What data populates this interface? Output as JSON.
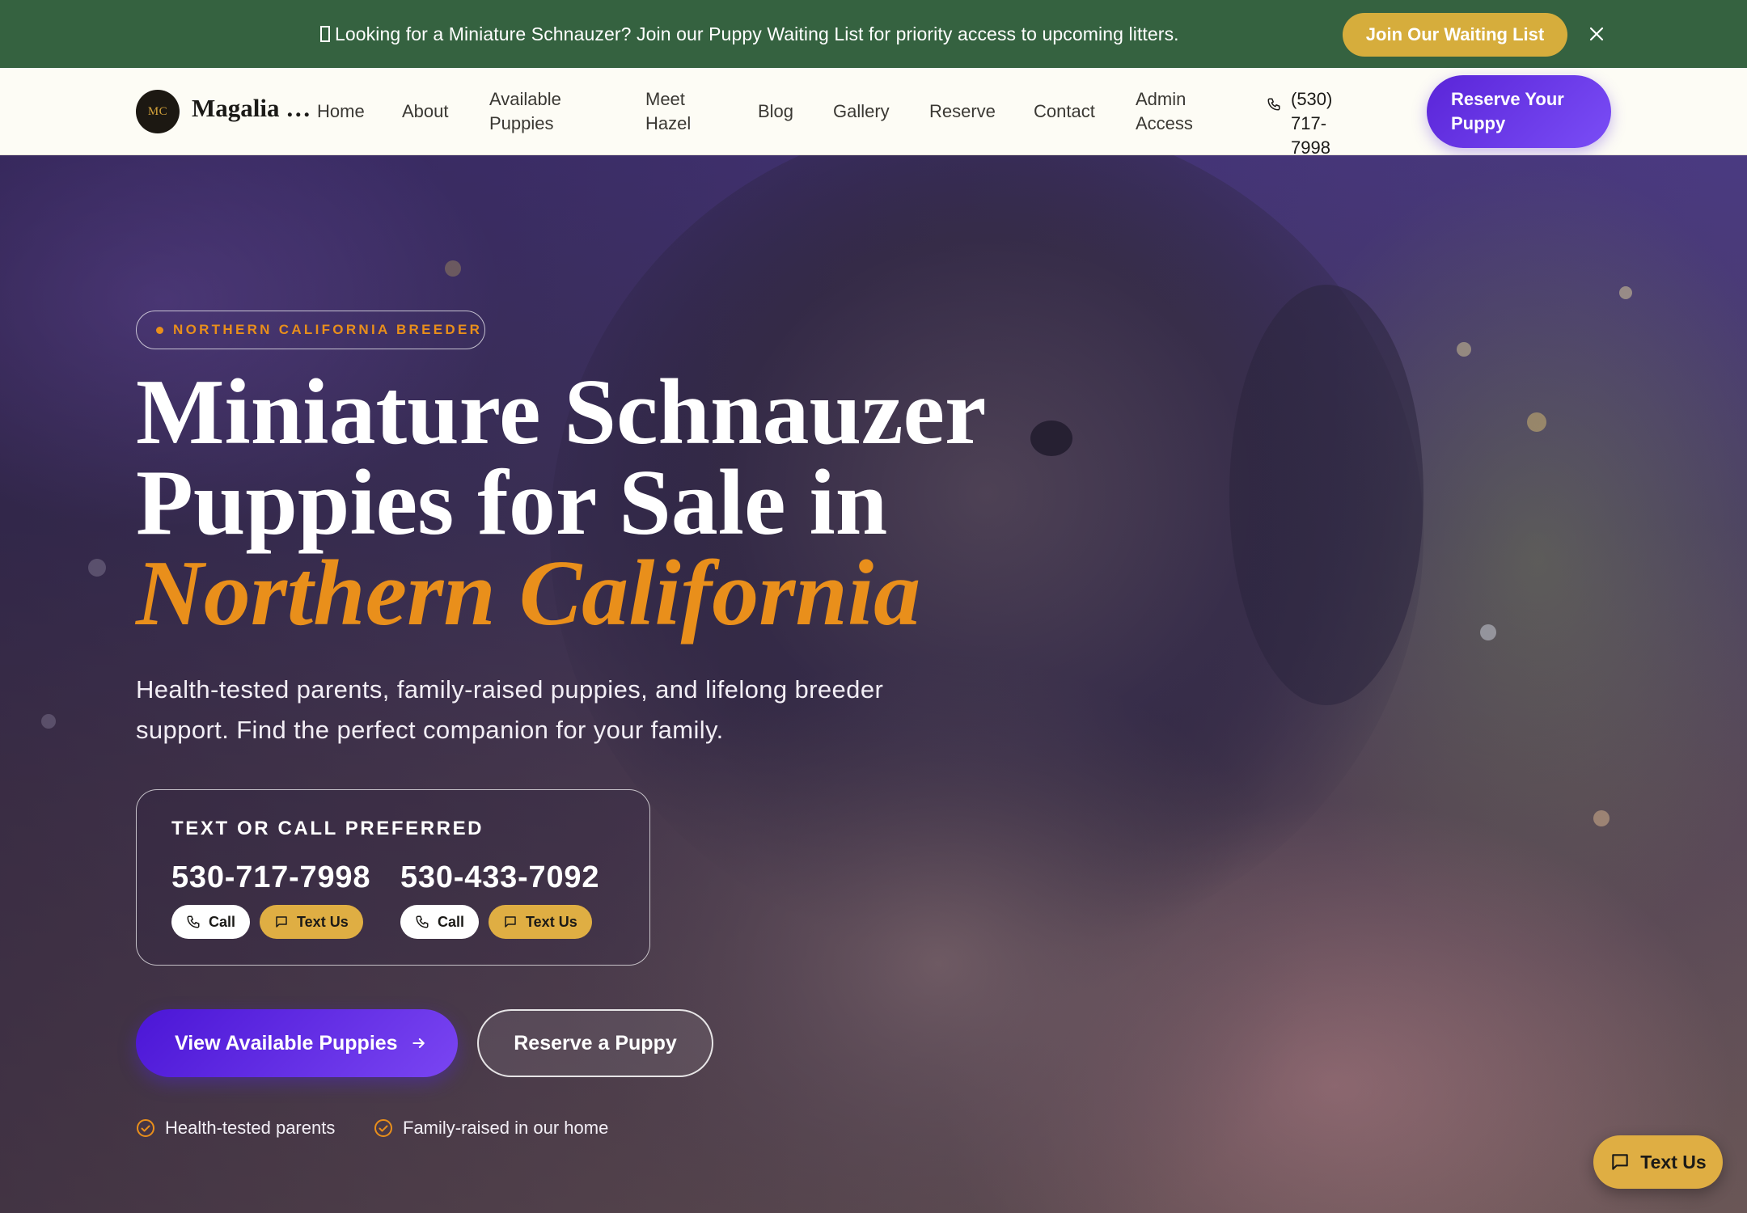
{
  "announcement": {
    "text": "Looking for a Miniature Schnauzer? Join our Puppy Waiting List for priority access to upcoming litters.",
    "button_label": "Join Our Waiting List"
  },
  "nav": {
    "logo_initials": "MC",
    "logo_name": "Magalia Ch",
    "links": {
      "home": "Home",
      "about": "About",
      "available_1": "Available",
      "available_2": "Puppies",
      "meet_1": "Meet",
      "meet_2": "Hazel",
      "blog": "Blog",
      "gallery": "Gallery",
      "reserve": "Reserve",
      "contact": "Contact",
      "admin_1": "Admin",
      "admin_2": "Access"
    },
    "phone_1": "(530) 717-",
    "phone_2": "7998",
    "cta_1": "Reserve Your",
    "cta_2": "Puppy"
  },
  "hero": {
    "badge": "NORTHERN CALIFORNIA BREEDER",
    "title_line1": "Miniature Schnauzer",
    "title_line2": "Puppies for Sale in",
    "title_accent": "Northern California",
    "subtitle": "Health-tested parents, family-raised puppies, and lifelong breeder support. Find the perfect companion for your family.",
    "contact_label": "TEXT OR CALL PREFERRED",
    "phones": [
      {
        "number": "530-717-7998",
        "call": "Call",
        "text": "Text Us"
      },
      {
        "number": "530-433-7092",
        "call": "Call",
        "text": "Text Us"
      }
    ],
    "primary_button": "View Available Puppies",
    "secondary_button": "Reserve a Puppy",
    "trust": [
      "Health-tested parents",
      "Family-raised in our home"
    ]
  },
  "floating_button": "Text Us",
  "colors": {
    "announcement_bg": "#356240",
    "gold": "#d6ad3c",
    "accent_orange": "#e98f1b",
    "purple": "#5a25d8",
    "nav_bg": "#fdfcf5"
  },
  "icons": [
    "close-icon",
    "phone-icon",
    "message-icon",
    "arrow-right-icon",
    "check-circle-icon"
  ]
}
